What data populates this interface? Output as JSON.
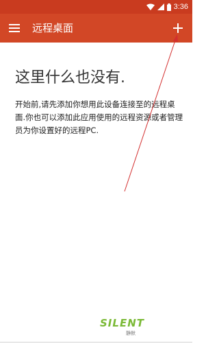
{
  "status_bar": {
    "time": "3:36"
  },
  "toolbar": {
    "title": "远程桌面"
  },
  "empty_state": {
    "title": "这里什么也没有.",
    "description": "开始前,请先添加你想用此设备连接至的远程桌面.你也可以添加此应用使用的远程资源或者管理员为你设置好的远程PC."
  },
  "watermark": {
    "brand": "SILENT",
    "sub": "静默"
  },
  "colors": {
    "toolbar": "#d24726",
    "status_bar": "#c93b1f",
    "annotation_arrow": "#d32f2f"
  }
}
